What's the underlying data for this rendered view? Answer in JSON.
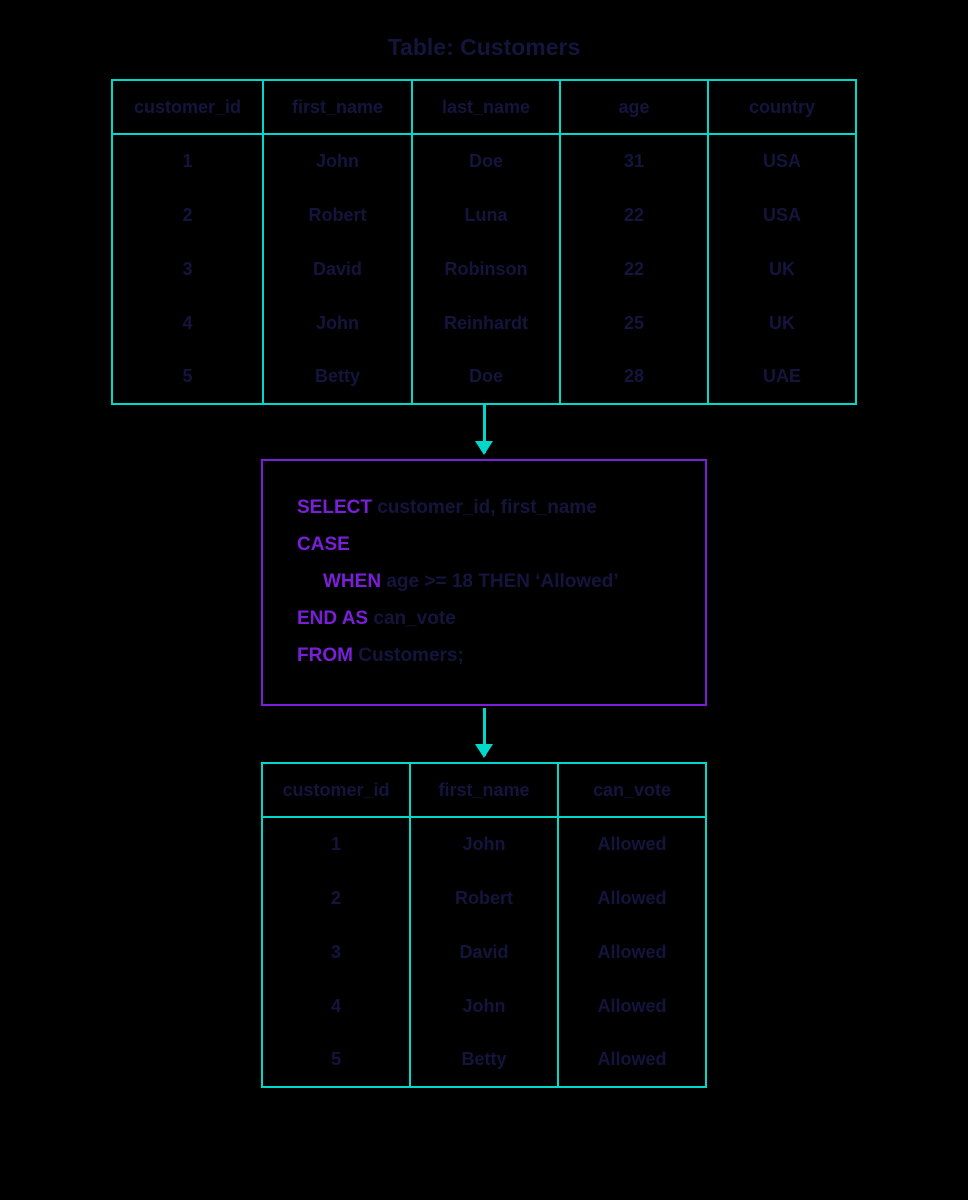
{
  "title": "Table: Customers",
  "source_table": {
    "headers": [
      "customer_id",
      "first_name",
      "last_name",
      "age",
      "country"
    ],
    "rows": [
      [
        "1",
        "John",
        "Doe",
        "31",
        "USA"
      ],
      [
        "2",
        "Robert",
        "Luna",
        "22",
        "USA"
      ],
      [
        "3",
        "David",
        "Robinson",
        "22",
        "UK"
      ],
      [
        "4",
        "John",
        "Reinhardt",
        "25",
        "UK"
      ],
      [
        "5",
        "Betty",
        "Doe",
        "28",
        "UAE"
      ]
    ]
  },
  "sql": {
    "select_kw": "SELECT",
    "select_cols": " customer_id, first_name",
    "case_kw": "CASE",
    "when_kw": "WHEN",
    "when_body": " age >= 18 THEN ‘Allowed’",
    "endas_kw": "END AS",
    "endas_body": " can_vote",
    "from_kw": "FROM",
    "from_body": " Customers;"
  },
  "result_table": {
    "headers": [
      "customer_id",
      "first_name",
      "can_vote"
    ],
    "rows": [
      [
        "1",
        "John",
        "Allowed"
      ],
      [
        "2",
        "Robert",
        "Allowed"
      ],
      [
        "3",
        "David",
        "Allowed"
      ],
      [
        "4",
        "John",
        "Allowed"
      ],
      [
        "5",
        "Betty",
        "Allowed"
      ]
    ]
  }
}
